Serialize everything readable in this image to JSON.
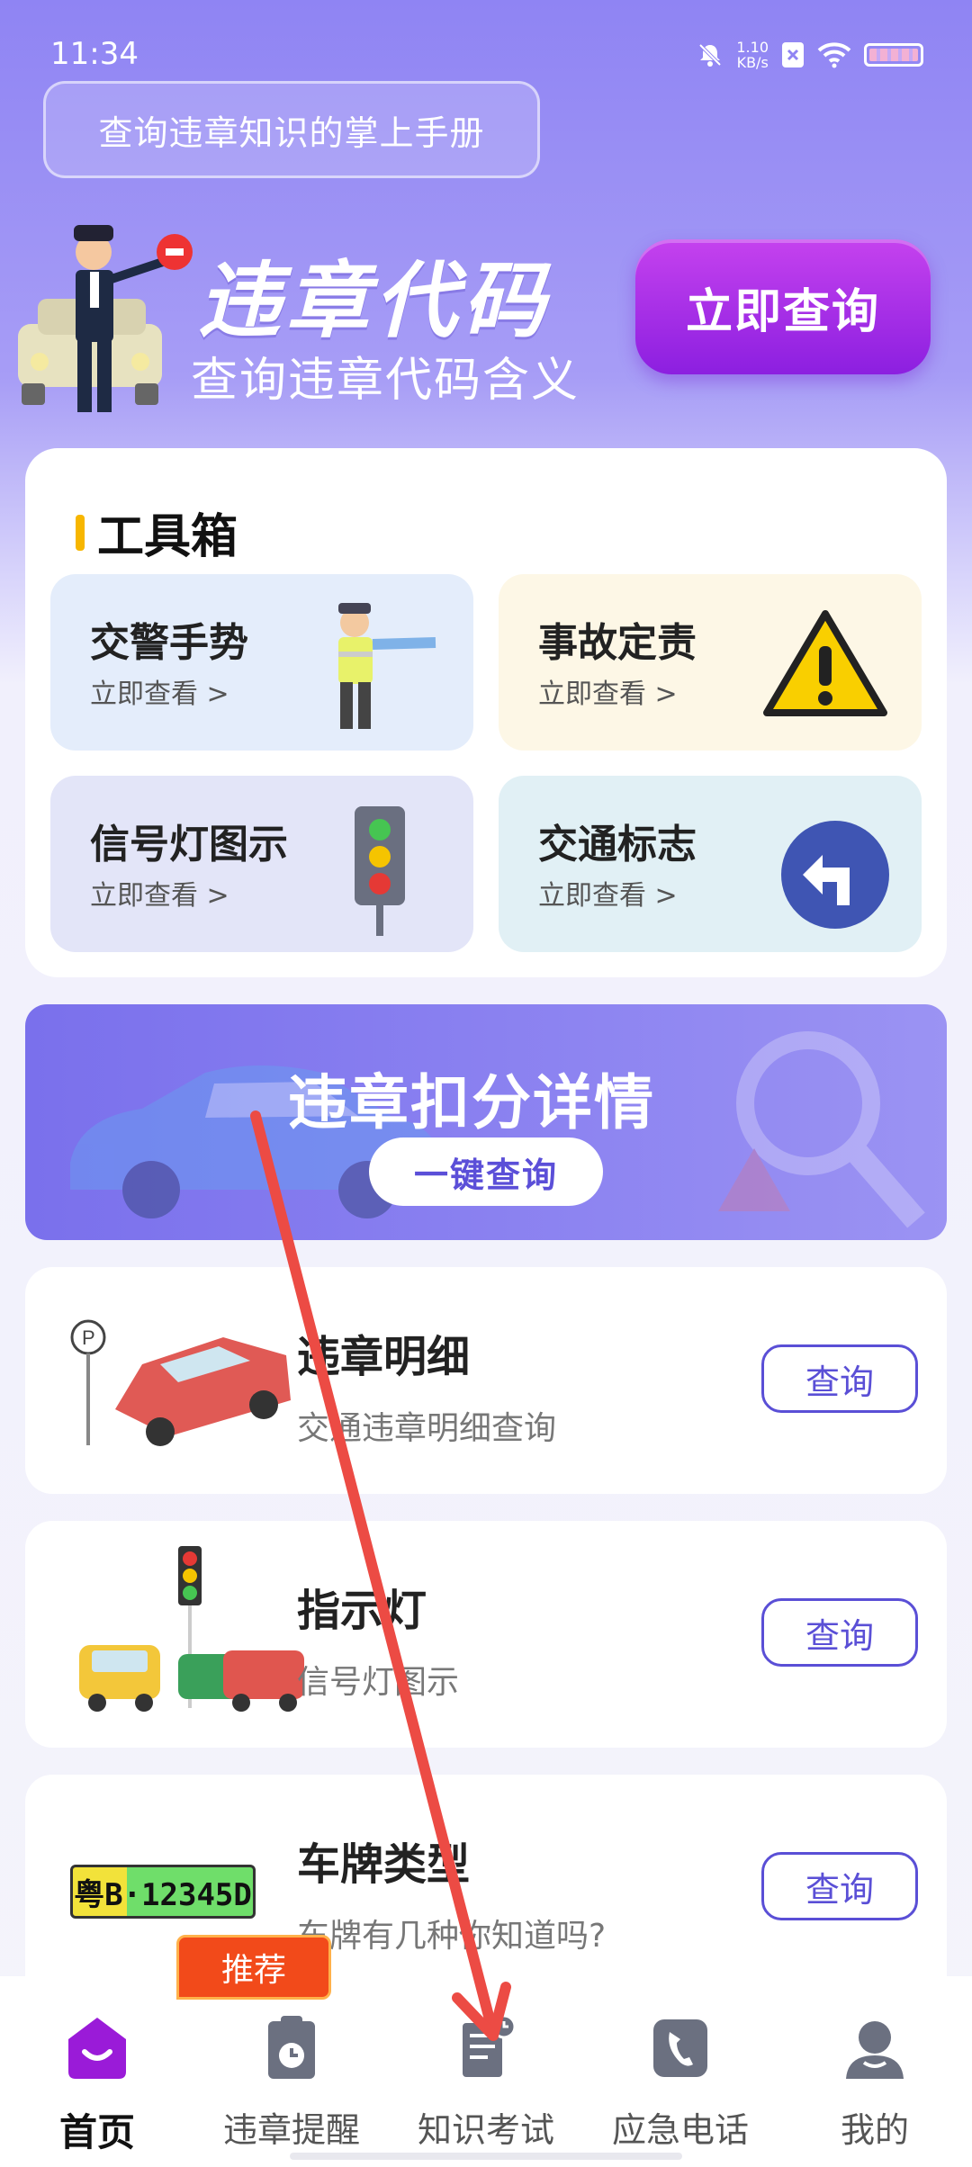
{
  "status_bar": {
    "time": "11:34",
    "net_speed_value": "1.10",
    "net_speed_unit": "KB/s"
  },
  "handbook_pill": "查询违章知识的掌上手册",
  "hero": {
    "title": "违章代码",
    "subtitle": "查询违章代码含义",
    "button": "立即查询"
  },
  "toolbox": {
    "title": "工具箱",
    "tiles": [
      {
        "title": "交警手势",
        "sub": "立即查看 >",
        "icon": "traffic-police-icon"
      },
      {
        "title": "事故定责",
        "sub": "立即查看 >",
        "icon": "warning-triangle-icon"
      },
      {
        "title": "信号灯图示",
        "sub": "立即查看 >",
        "icon": "traffic-light-icon"
      },
      {
        "title": "交通标志",
        "sub": "立即查看 >",
        "icon": "turn-left-sign-icon"
      }
    ]
  },
  "banner": {
    "title": "违章扣分详情",
    "button": "一键查询"
  },
  "list": [
    {
      "title": "违章明细",
      "sub": "交通违章明细查询",
      "button": "查询"
    },
    {
      "title": "指示灯",
      "sub": "信号灯图示",
      "button": "查询"
    },
    {
      "title": "车牌类型",
      "sub": "车牌有几种你知道吗?",
      "button": "查询",
      "plate": "粤B·12345D"
    }
  ],
  "recommend_badge": "推荐",
  "nav": [
    {
      "label": "首页",
      "icon": "home-icon",
      "active": true
    },
    {
      "label": "违章提醒",
      "icon": "clipboard-clock-icon"
    },
    {
      "label": "知识考试",
      "icon": "exam-paper-icon"
    },
    {
      "label": "应急电话",
      "icon": "phone-icon"
    },
    {
      "label": "我的",
      "icon": "user-icon"
    }
  ],
  "colors": {
    "accent": "#5a4fd6",
    "hero_button": "#a532e8",
    "badge": "#f24a1a",
    "toolbox_bar": "#f7b600"
  }
}
